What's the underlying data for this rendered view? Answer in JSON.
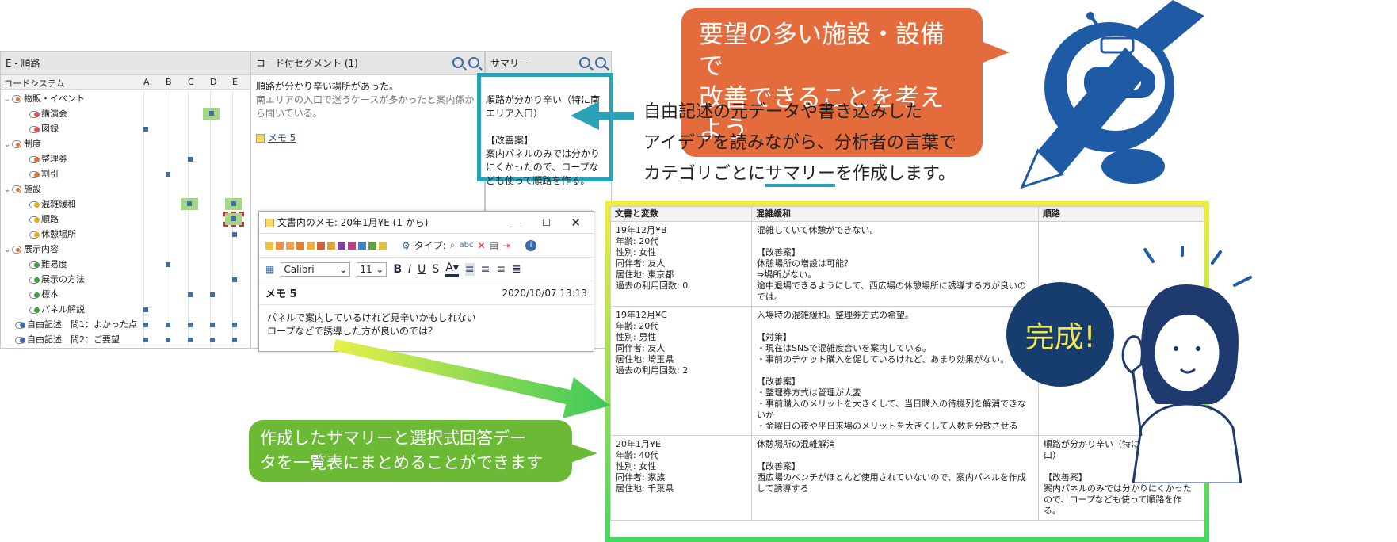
{
  "code_system_panel": {
    "title": "E - 順路",
    "header": "コードシステム",
    "columns": [
      "A",
      "B",
      "C",
      "D",
      "E"
    ],
    "rows": [
      {
        "label": "物販・イベント",
        "level": 0,
        "kind": "folder"
      },
      {
        "label": "講演会",
        "level": 1,
        "kind": "code",
        "color": "#e05050"
      },
      {
        "label": "図録",
        "level": 1,
        "kind": "code",
        "color": "#e05050"
      },
      {
        "label": "制度",
        "level": 0,
        "kind": "folder"
      },
      {
        "label": "整理券",
        "level": 1,
        "kind": "code",
        "color": "#e07030"
      },
      {
        "label": "割引",
        "level": 1,
        "kind": "code",
        "color": "#e07030"
      },
      {
        "label": "施設",
        "level": 0,
        "kind": "folder"
      },
      {
        "label": "混雑緩和",
        "level": 1,
        "kind": "code",
        "color": "#e0b020"
      },
      {
        "label": "順路",
        "level": 1,
        "kind": "code",
        "color": "#e0b020"
      },
      {
        "label": "休憩場所",
        "level": 1,
        "kind": "code",
        "color": "#e0b020"
      },
      {
        "label": "展示内容",
        "level": 0,
        "kind": "folder"
      },
      {
        "label": "難易度",
        "level": 1,
        "kind": "code",
        "color": "#40a040"
      },
      {
        "label": "展示の方法",
        "level": 1,
        "kind": "code",
        "color": "#40a040"
      },
      {
        "label": "標本",
        "level": 1,
        "kind": "code",
        "color": "#40a040"
      },
      {
        "label": "パネル解説",
        "level": 1,
        "kind": "code",
        "color": "#40a040"
      },
      {
        "label": "自由記述　問1：よかった点",
        "level": 0,
        "kind": "code",
        "color": "#3c6aa5"
      },
      {
        "label": "自由記述　問2：ご要望",
        "level": 0,
        "kind": "code",
        "color": "#3c6aa5"
      }
    ]
  },
  "coded_segments_panel": {
    "title": "コード付セグメント (1)",
    "line1": "順路が分かり辛い場所があった。",
    "line2": "南エリアの入口で迷うケースが多かったと案内係から聞いている。",
    "memo_link": "メモ 5"
  },
  "summary_panel": {
    "title": "サマリー",
    "text": "順路が分かり辛い（特に南エリア入口）\n\n【改善案】\n案内パネルのみでは分かりにくかったので、ロープなども使って順路を作る。"
  },
  "memo_window": {
    "title": "文書内のメモ: 20年1月¥E (1 から)",
    "type_label": "タイプ:",
    "font": "Calibri",
    "font_size": "11",
    "memo_title": "メモ 5",
    "timestamp": "2020/10/07 13:13",
    "body_line1": "パネルで案内しているけれど見辛いかもしれない",
    "body_line2": "ロープなどで誘導した方が良いのでは？"
  },
  "callouts": {
    "orange_line1": "要望の多い施設・設備で",
    "orange_line2": "改善できることを考えよう",
    "explain_line1": "自由記述の元データや書き込みした",
    "explain_line2": "アイデアを読みながら、分析者の言葉で",
    "explain_line3_pre": "カテゴリごとに",
    "explain_line3_emph": "サマリー",
    "explain_line3_post": "を作成します。",
    "green_line1": "作成したサマリーと選択式回答デー",
    "green_line2": "タを一覧表にまとめることができます",
    "done": "完成!"
  },
  "summary_table": {
    "headers": [
      "文書と変数",
      "混雑緩和",
      "順路"
    ],
    "rows": [
      {
        "doc": "19年12月¥B\n年齢: 20代\n性別: 女性\n同伴者: 友人\n居住地: 東京都\n過去の利用回数: 0",
        "congestion": "混雑していて休憩ができない。\n\n【改善案】\n休憩場所の増設は可能？\n⇒場所がない。\n途中退場できるようにして、西広場の休憩場所に誘導する方が良いのでは。",
        "route": ""
      },
      {
        "doc": "19年12月¥C\n年齢: 20代\n性別: 男性\n同伴者: 友人\n居住地: 埼玉県\n過去の利用回数: 2",
        "congestion": "入場時の混雑緩和。整理券方式の希望。\n\n【対策】\n・現在はSNSで混雑度合いを案内している。\n・事前のチケット購入を促しているけれど、あまり効果がない。\n\n【改善案】\n・整理券方式は管理が大変\n・事前購入のメリットを大きくして、当日購入の待機列を解消できないか\n・金曜日の夜や平日来場のメリットを大きくして人数を分散させる",
        "route": ""
      },
      {
        "doc": "20年1月¥E\n年齢: 40代\n性別: 女性\n同伴者: 家族\n居住地: 千葉県",
        "congestion": "休憩場所の混雑解消\n\n【改善案】\n西広場のベンチがほとんど使用されていないので、案内パネルを作成して誘導する",
        "route": "順路が分かり辛い（特に南エリア入口）\n\n【改善案】\n案内パネルのみでは分かりにくかったので、ロープなども使って順路を作る。"
      }
    ]
  }
}
